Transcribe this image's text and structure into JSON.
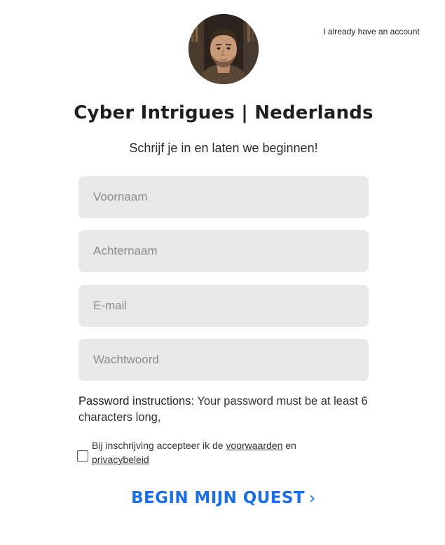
{
  "header": {
    "login_link": "I already have an account",
    "avatar": "profile-portrait-man"
  },
  "form": {
    "title": "Cyber Intrigues | Nederlands",
    "subtitle": "Schrijf je in en laten we beginnen!",
    "fields": {
      "first_name": {
        "placeholder": "Voornaam",
        "value": ""
      },
      "last_name": {
        "placeholder": "Achternaam",
        "value": ""
      },
      "email": {
        "placeholder": "E-mail",
        "value": ""
      },
      "password": {
        "placeholder": "Wachtwoord",
        "value": ""
      }
    },
    "password_instructions": {
      "label": "Password instructions",
      "text": ": Your password must be at least 6 characters long,"
    },
    "terms": {
      "checked": false,
      "text_before": "Bij inschrijving accepteer ik de ",
      "terms_link": "voorwaarden",
      "text_middle": " en ",
      "privacy_link": "privacybeleid"
    },
    "submit": {
      "label": "BEGIN MIJN QUEST",
      "chevron": "›",
      "icon": "chevron-right-icon"
    }
  },
  "colors": {
    "accent": "#1a6fe6",
    "field_background": "#e8e8e8",
    "text": "#1e1e1e"
  }
}
